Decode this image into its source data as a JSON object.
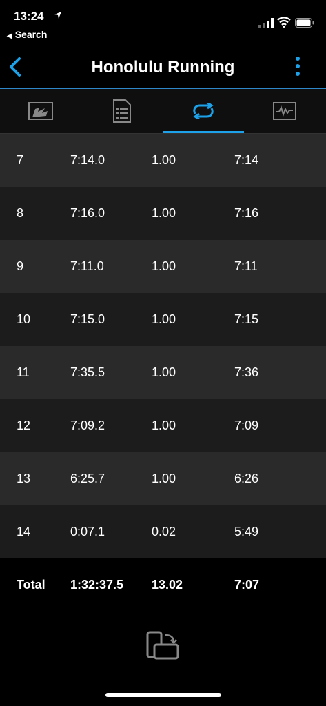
{
  "status": {
    "time": "13:24",
    "back_label": "Search"
  },
  "nav": {
    "title": "Honolulu Running"
  },
  "tabs": [
    {
      "icon": "map-chart-icon"
    },
    {
      "icon": "document-list-icon"
    },
    {
      "icon": "laps-repeat-icon",
      "active": true
    },
    {
      "icon": "activity-graph-icon"
    }
  ],
  "laps": [
    [
      "7",
      "7:14.0",
      "1.00",
      "7:14"
    ],
    [
      "8",
      "7:16.0",
      "1.00",
      "7:16"
    ],
    [
      "9",
      "7:11.0",
      "1.00",
      "7:11"
    ],
    [
      "10",
      "7:15.0",
      "1.00",
      "7:15"
    ],
    [
      "11",
      "7:35.5",
      "1.00",
      "7:36"
    ],
    [
      "12",
      "7:09.2",
      "1.00",
      "7:09"
    ],
    [
      "13",
      "6:25.7",
      "1.00",
      "6:26"
    ],
    [
      "14",
      "0:07.1",
      "0.02",
      "5:49"
    ]
  ],
  "total": [
    "Total",
    "1:32:37.5",
    "13.02",
    "7:07"
  ],
  "colors": {
    "accent": "#1da1e8",
    "row_light": "#2a2a2a",
    "row_dark": "#1c1c1c"
  }
}
